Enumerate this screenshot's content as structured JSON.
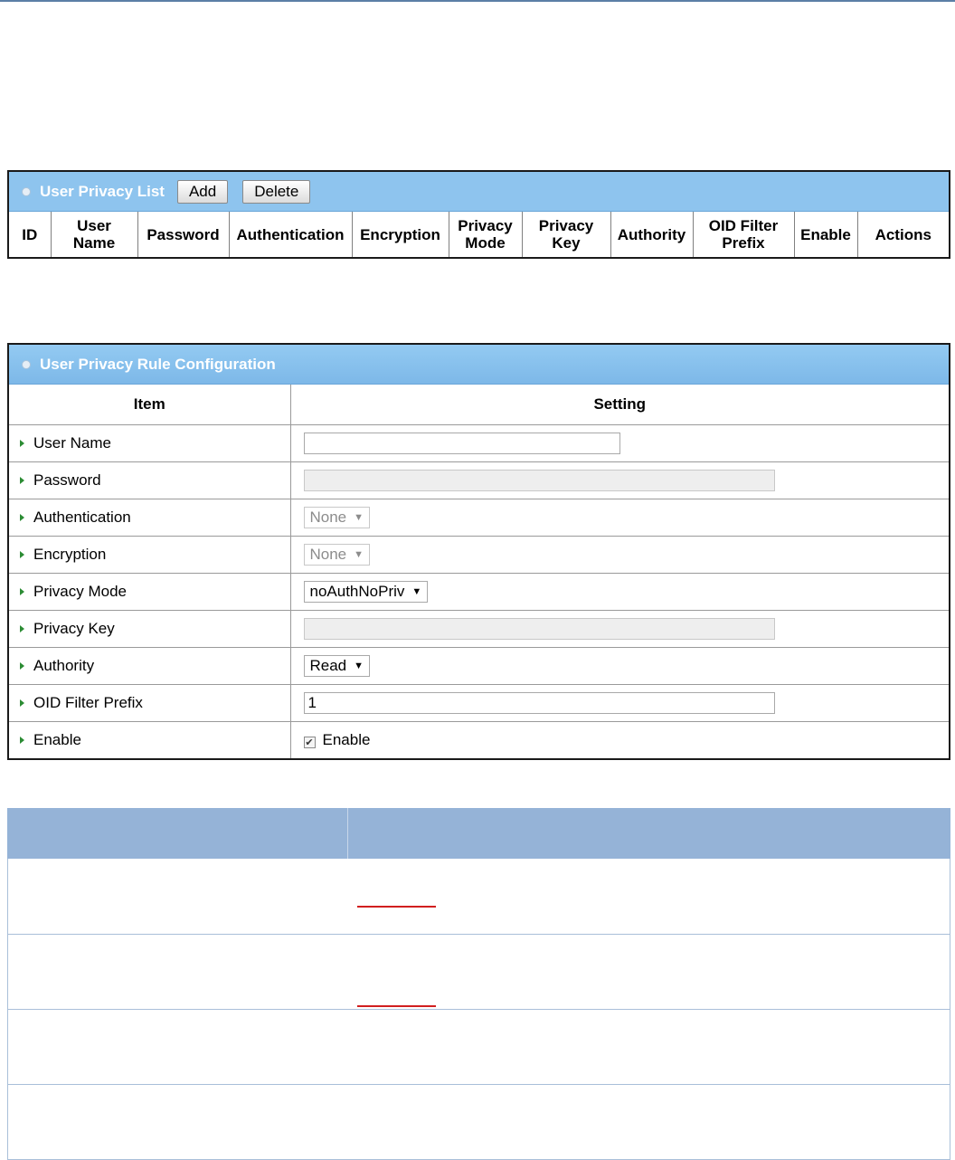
{
  "list": {
    "title": "User Privacy List",
    "add_label": "Add",
    "delete_label": "Delete",
    "columns": [
      {
        "line1": "ID",
        "line2": ""
      },
      {
        "line1": "User",
        "line2": "Name"
      },
      {
        "line1": "Password",
        "line2": ""
      },
      {
        "line1": "Authentication",
        "line2": ""
      },
      {
        "line1": "Encryption",
        "line2": ""
      },
      {
        "line1": "Privacy",
        "line2": "Mode"
      },
      {
        "line1": "Privacy",
        "line2": "Key"
      },
      {
        "line1": "Authority",
        "line2": ""
      },
      {
        "line1": "OID Filter",
        "line2": "Prefix"
      },
      {
        "line1": "Enable",
        "line2": ""
      },
      {
        "line1": "Actions",
        "line2": ""
      }
    ]
  },
  "config": {
    "title": "User Privacy Rule Configuration",
    "header_item": "Item",
    "header_setting": "Setting",
    "rows": {
      "user_name": {
        "label": "User Name",
        "value": ""
      },
      "password": {
        "label": "Password",
        "value": ""
      },
      "authentication": {
        "label": "Authentication",
        "value": "None"
      },
      "encryption": {
        "label": "Encryption",
        "value": "None"
      },
      "privacy_mode": {
        "label": "Privacy Mode",
        "value": "noAuthNoPriv"
      },
      "privacy_key": {
        "label": "Privacy Key",
        "value": ""
      },
      "authority": {
        "label": "Authority",
        "value": "Read"
      },
      "oid_filter_prefix": {
        "label": "OID Filter Prefix",
        "value": "1"
      },
      "enable": {
        "label": "Enable",
        "checkbox_label": "Enable",
        "checked": true
      }
    }
  },
  "colors": {
    "panel_header": "#8ec4ee",
    "desc_header": "#95b3d7",
    "bullet_green": "#2c8c34",
    "red_underline": "#d11f1f"
  }
}
